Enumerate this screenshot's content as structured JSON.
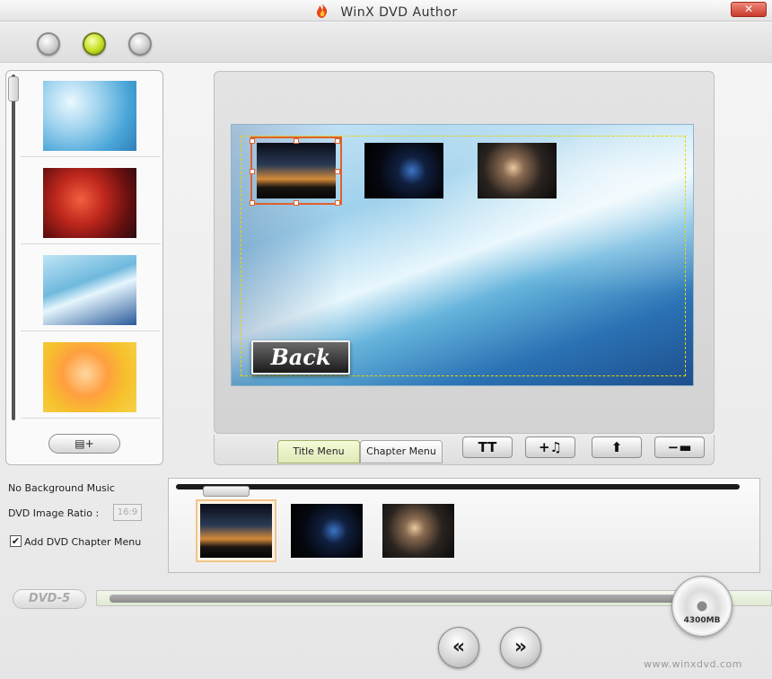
{
  "window": {
    "title": "WinX DVD Author",
    "close_label": "✕"
  },
  "icons": {
    "close": "close-icon",
    "flame": "flame-logo-icon",
    "add_background": "add-background-icon",
    "text": "text-icon",
    "add_music": "add-music-icon",
    "move_up": "arrow-up-icon",
    "remove": "remove-icon",
    "previous": "double-chevron-left-icon",
    "next": "double-chevron-right-icon"
  },
  "steps": [
    "step-1",
    "step-2",
    "step-3"
  ],
  "active_step": 2,
  "left_panel": {
    "add_button_label": "▤+",
    "backgrounds": [
      "blue-sparkle",
      "red-flowers",
      "blue-wave",
      "orange-roses"
    ]
  },
  "preview": {
    "back_button_label": "Back"
  },
  "tabs": [
    {
      "label": "Title Menu",
      "active": true
    },
    {
      "label": "Chapter Menu",
      "active": false
    }
  ],
  "tools": {
    "text_label": "TT",
    "music_label": "+♫",
    "up_label": "⬆",
    "remove_label": "−▬"
  },
  "options": {
    "music_status": "No Background Music",
    "ratio_label": "DVD Image Ratio :",
    "ratio_value": "16:9",
    "chapter_menu_label": "Add DVD Chapter Menu",
    "chapter_menu_checked": true,
    "check_mark": "✔"
  },
  "bottom": {
    "dvd_type": "DVD-5",
    "disc_capacity": "4300MB",
    "usage_fraction": 0.87,
    "prev_label": "«",
    "next_label": "»",
    "watermark": "www.winxdvd.com"
  },
  "colors": {
    "accent_green": "#c6df22",
    "selection_orange": "#e0612c",
    "safe_area_yellow": "#e6d600"
  }
}
